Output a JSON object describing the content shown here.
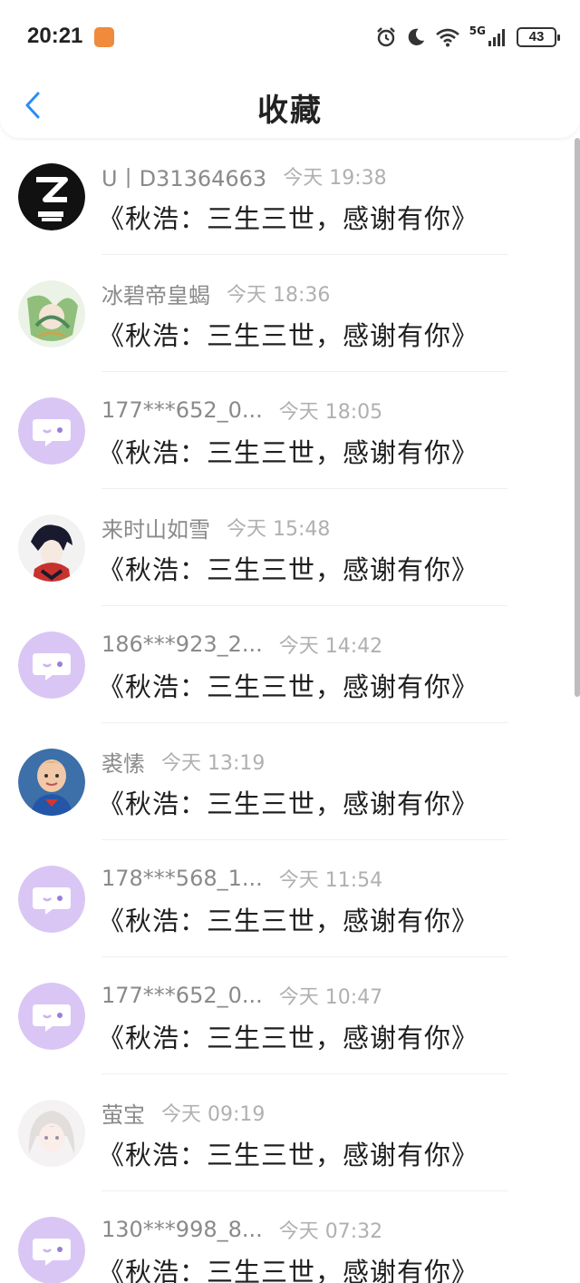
{
  "status_bar": {
    "time": "20:21",
    "battery": "43",
    "network": "5G"
  },
  "header": {
    "title": "收藏"
  },
  "favorites": [
    {
      "username": "U丨D31364663",
      "time": "今天 19:38",
      "message": "《秋浩：三生三世，感谢有你》",
      "avatar": "logo-avatar"
    },
    {
      "username": "冰碧帝皇蝎",
      "time": "今天 18:36",
      "message": "《秋浩：三生三世，感谢有你》",
      "avatar": "anime-green-avatar"
    },
    {
      "username": "177***652_0...",
      "time": "今天 18:05",
      "message": "《秋浩：三生三世，感谢有你》",
      "avatar": "default-chat-avatar"
    },
    {
      "username": "来时山如雪",
      "time": "今天 15:48",
      "message": "《秋浩：三生三世，感谢有你》",
      "avatar": "anime-dark-avatar"
    },
    {
      "username": "186***923_2...",
      "time": "今天 14:42",
      "message": "《秋浩：三生三世，感谢有你》",
      "avatar": "default-chat-avatar"
    },
    {
      "username": "裘愫",
      "time": "今天 13:19",
      "message": "《秋浩：三生三世，感谢有你》",
      "avatar": "photo-child-avatar"
    },
    {
      "username": "178***568_1...",
      "time": "今天 11:54",
      "message": "《秋浩：三生三世，感谢有你》",
      "avatar": "default-chat-avatar"
    },
    {
      "username": "177***652_0...",
      "time": "今天 10:47",
      "message": "《秋浩：三生三世，感谢有你》",
      "avatar": "default-chat-avatar"
    },
    {
      "username": "萤宝",
      "time": "今天 09:19",
      "message": "《秋浩：三生三世，感谢有你》",
      "avatar": "anime-white-avatar"
    },
    {
      "username": "130***998_8...",
      "time": "今天 07:32",
      "message": "《秋浩：三生三世，感谢有你》",
      "avatar": "default-chat-avatar"
    }
  ],
  "colors": {
    "accent": "#2d8cf0",
    "default_avatar": "#d9c6f5",
    "username": "#8a8a8a",
    "timestamp": "#b0b0b0"
  }
}
